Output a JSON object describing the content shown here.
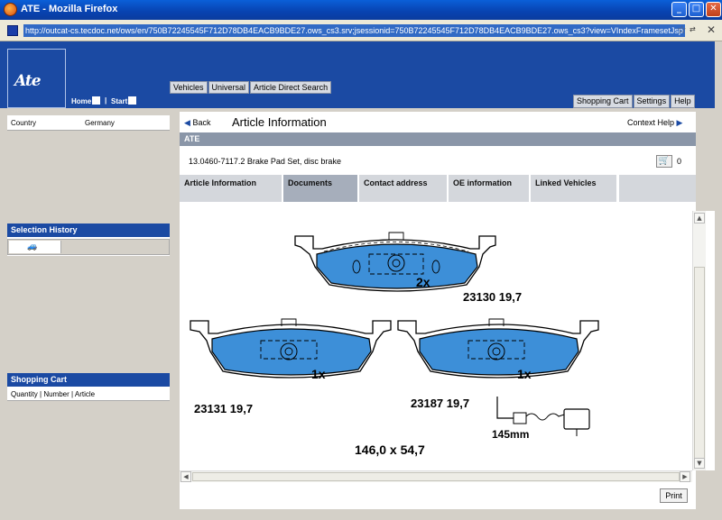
{
  "window": {
    "title": "ATE - Mozilla Firefox",
    "url": "http://outcat-cs.tecdoc.net/ows/en/750B72245545F712D78DB4EACB9BDE27.ows_cs3.srv;jsessionid=750B72245545F712D78DB4EACB9BDE27.ows_cs3?view=VIndexFramesetJsp",
    "minimize": "_",
    "maximize": "□",
    "close": "✕"
  },
  "header": {
    "logo_text": "Ate",
    "home_label": "Home",
    "start_label": "Start",
    "separator": "|",
    "top_tabs": [
      "Vehicles",
      "Universal",
      "Article Direct Search"
    ],
    "right_tabs": [
      "Shopping Cart",
      "Settings",
      "Help"
    ]
  },
  "sidebar": {
    "country_label": "Country",
    "country_value": "Germany",
    "history_title": "Selection History",
    "cart_title": "Shopping Cart",
    "cart_columns": "Quantity | Number | Article"
  },
  "main": {
    "back_label": "Back",
    "page_title": "Article Information",
    "context_help": "Context Help",
    "brand_bar": "ATE",
    "article_text": "13.0460-7117.2 Brake Pad Set, disc brake",
    "cart_count": "0",
    "subtabs": [
      "Article Information",
      "Documents",
      "Contact address",
      "OE information",
      "Linked Vehicles"
    ],
    "active_subtab": 1,
    "print_label": "Print"
  },
  "drawing": {
    "pad_top_qty": "2x",
    "pad_top_code": "23130 19,7",
    "pad_left_qty": "1x",
    "pad_left_code": "23131 19,7",
    "pad_right_qty": "1x",
    "pad_right_code": "23187 19,7",
    "wire_length": "145mm",
    "dimensions": "146,0 x 54,7",
    "pad_color": "#3d8fd8"
  }
}
